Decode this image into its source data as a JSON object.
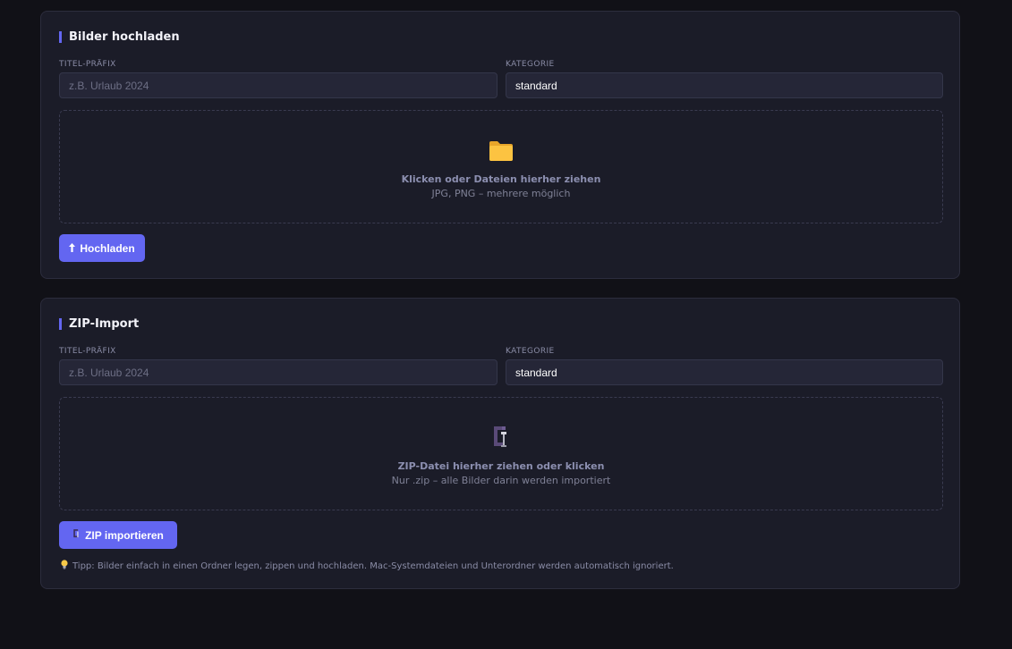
{
  "upload": {
    "title": "Bilder hochladen",
    "prefix_label": "TITEL-PRÄFIX",
    "prefix_placeholder": "z.B. Urlaub 2024",
    "prefix_value": "",
    "category_label": "KATEGORIE",
    "category_value": "standard",
    "drop_icon": "folder-icon",
    "drop_title": "Klicken oder Dateien hierher ziehen",
    "drop_subtitle": "JPG, PNG – mehrere möglich",
    "button_label": "Hochladen",
    "button_icon": "upload-arrow-icon"
  },
  "zip": {
    "title": "ZIP-Import",
    "prefix_label": "TITEL-PRÄFIX",
    "prefix_placeholder": "z.B. Urlaub 2024",
    "prefix_value": "",
    "category_label": "KATEGORIE",
    "category_value": "standard",
    "drop_icon": "clamp-icon",
    "drop_title": "ZIP-Datei hierher ziehen oder klicken",
    "drop_subtitle": "Nur .zip – alle Bilder darin werden importiert",
    "button_label": "ZIP importieren",
    "button_icon": "clamp-icon",
    "tip_icon": "lightbulb-icon",
    "tip_text": "Tipp: Bilder einfach in einen Ordner legen, zippen und hochladen. Mac-Systemdateien und Unterordner werden automatisch ignoriert."
  },
  "colors": {
    "accent": "#6366f1",
    "background": "#111117",
    "card": "#1b1c28",
    "input": "#252637"
  }
}
